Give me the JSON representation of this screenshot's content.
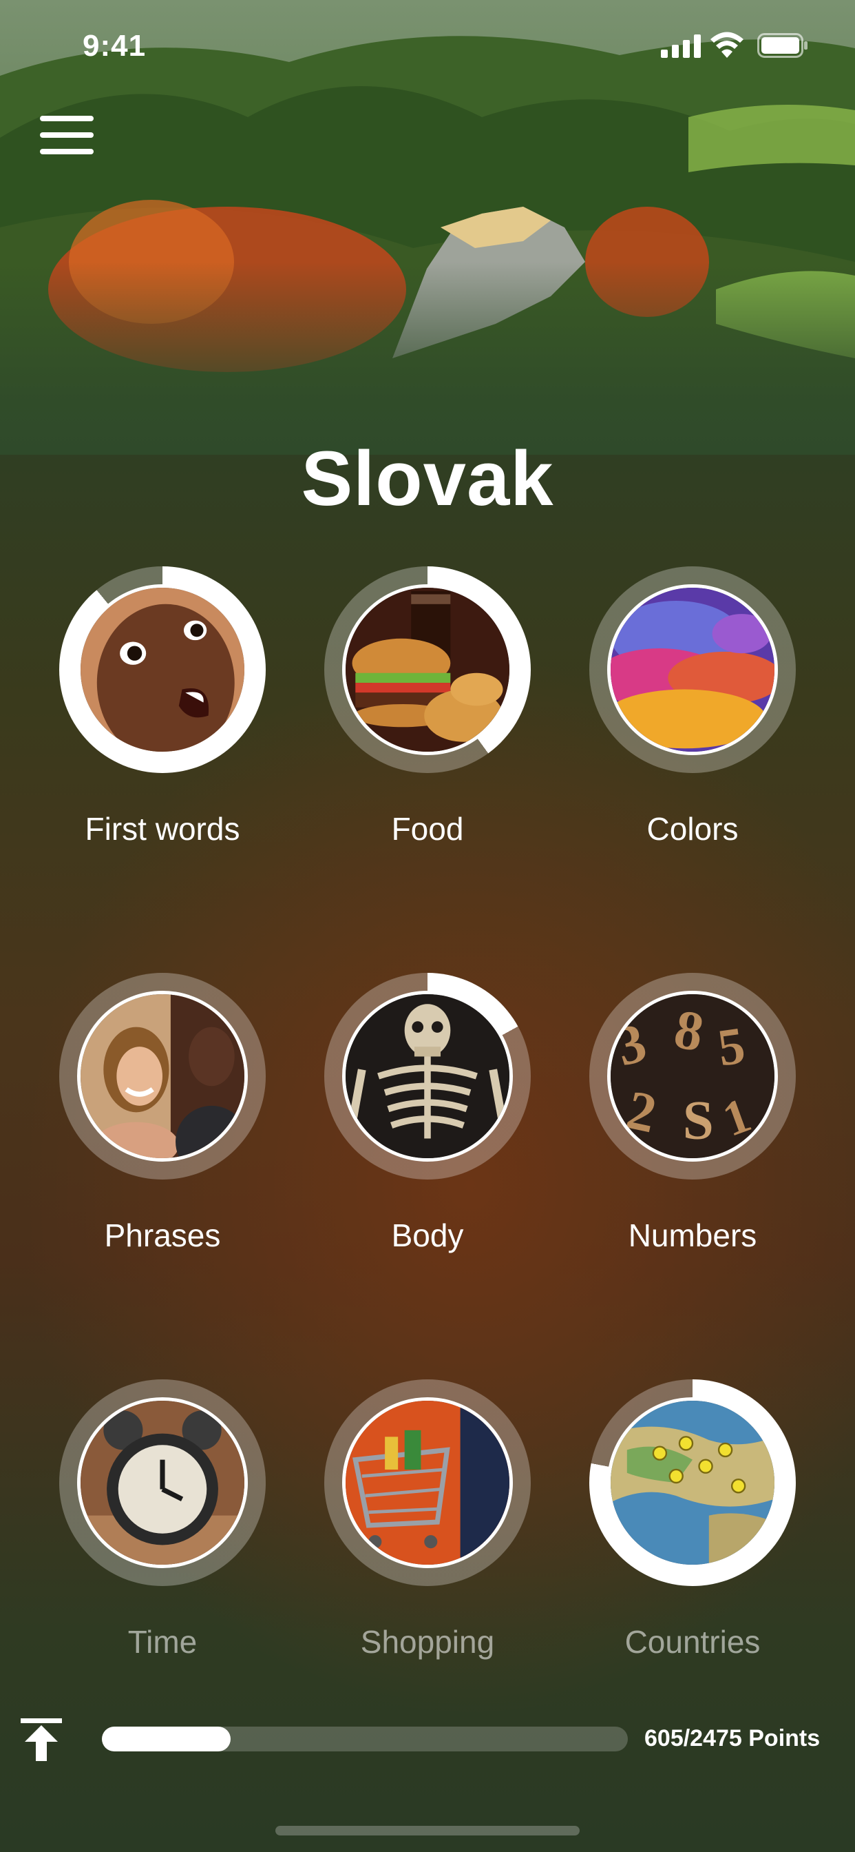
{
  "status": {
    "time": "9:41"
  },
  "language": {
    "title": "Slovak"
  },
  "topics": [
    {
      "label": "First words",
      "progress": 0.89,
      "image": "baby-face"
    },
    {
      "label": "Food",
      "progress": 0.4,
      "image": "burger-and-cola"
    },
    {
      "label": "Colors",
      "progress": 0.0,
      "image": "color-powder"
    },
    {
      "label": "Phrases",
      "progress": 0.0,
      "image": "couple-talking"
    },
    {
      "label": "Body",
      "progress": 0.17,
      "image": "skeleton"
    },
    {
      "label": "Numbers",
      "progress": 0.0,
      "image": "wooden-numbers"
    },
    {
      "label": "Time",
      "progress": 0.0,
      "image": "alarm-clock"
    },
    {
      "label": "Shopping",
      "progress": 0.0,
      "image": "shopping-cart"
    },
    {
      "label": "Countries",
      "progress": 0.78,
      "image": "map-with-pins"
    }
  ],
  "footer": {
    "points_text": "605/2475 Points",
    "points_earned": 605,
    "points_total": 2475
  },
  "icons": [
    "menu-icon",
    "signal-icon",
    "wifi-icon",
    "battery-icon",
    "upload-icon"
  ]
}
